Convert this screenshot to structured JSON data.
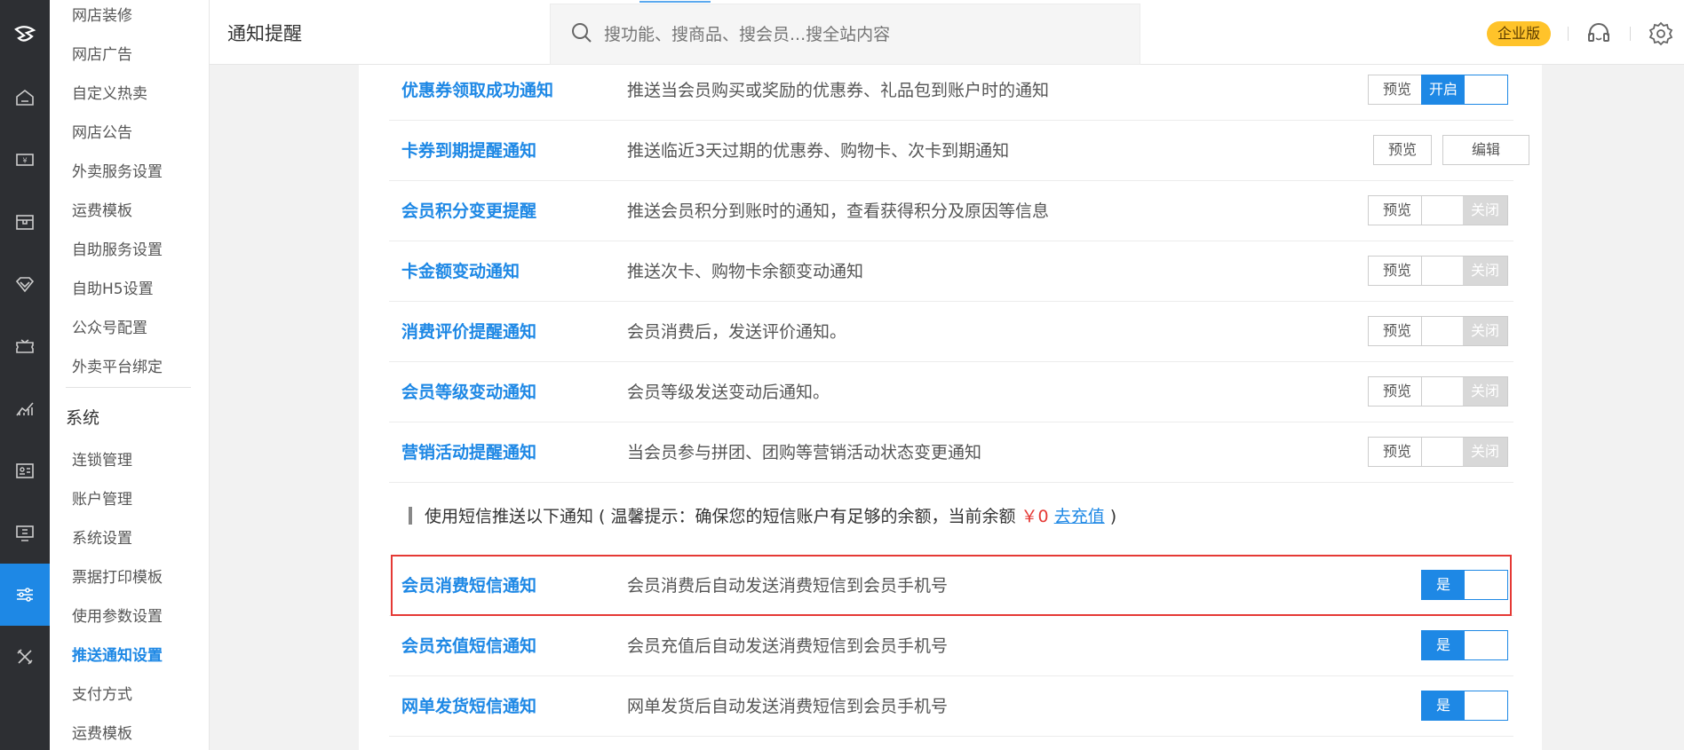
{
  "header": {
    "title": "通知提醒",
    "search_placeholder": "搜功能、搜商品、搜会员...搜全站内容",
    "edition_badge": "企业版"
  },
  "rail_icons": [
    "logo-icon",
    "home-icon",
    "cash-icon",
    "goods-icon",
    "member-icon",
    "coupon-icon",
    "chart-icon",
    "card-icon",
    "screen-icon",
    "settings-sliders-icon",
    "tools-icon"
  ],
  "submenu": {
    "items_top": [
      "网店装修",
      "网店广告",
      "自定义热卖",
      "网店公告",
      "外卖服务设置",
      "运费模板",
      "自助服务设置",
      "自助H5设置",
      "公众号配置",
      "外卖平台绑定"
    ],
    "group_label": "系统",
    "items_system": [
      "连锁管理",
      "账户管理",
      "系统设置",
      "票据打印模板",
      "使用参数设置",
      "推送通知设置",
      "支付方式",
      "运费模板"
    ],
    "active_item": "推送通知设置"
  },
  "rows": [
    {
      "name": "优惠券领取成功通知",
      "desc": "推送当会员购买或奖励的优惠券、礼品包到账户时的通知",
      "preview": "预览",
      "toggle_label": "开启",
      "toggle_on": true
    },
    {
      "name": "卡券到期提醒通知",
      "desc": "推送临近3天过期的优惠券、购物卡、次卡到期通知",
      "preview": "预览",
      "edit": "编辑"
    },
    {
      "name": "会员积分变更提醒",
      "desc": "推送会员积分到账时的通知，查看获得积分及原因等信息",
      "preview": "预览",
      "toggle_label": "关闭",
      "toggle_on": false
    },
    {
      "name": "卡金额变动通知",
      "desc": "推送次卡、购物卡余额变动通知",
      "preview": "预览",
      "toggle_label": "关闭",
      "toggle_on": false
    },
    {
      "name": "消费评价提醒通知",
      "desc": "会员消费后，发送评价通知。",
      "preview": "预览",
      "toggle_label": "关闭",
      "toggle_on": false
    },
    {
      "name": "会员等级变动通知",
      "desc": "会员等级发送变动后通知。",
      "preview": "预览",
      "toggle_label": "关闭",
      "toggle_on": false
    },
    {
      "name": "营销活动提醒通知",
      "desc": "当会员参与拼团、团购等营销活动状态变更通知",
      "preview": "预览",
      "toggle_label": "关闭",
      "toggle_on": false
    }
  ],
  "sms_note": {
    "prefix": "使用短信推送以下通知 ( 温馨提示：确保您的短信账户有足够的余额，当前余额",
    "balance": "￥0",
    "recharge_link": "去充值",
    "suffix": ")"
  },
  "sms_rows": [
    {
      "name": "会员消费短信通知",
      "desc": "会员消费后自动发送消费短信到会员手机号",
      "toggle_label": "是",
      "toggle_on": true
    },
    {
      "name": "会员充值短信通知",
      "desc": "会员充值后自动发送消费短信到会员手机号",
      "toggle_label": "是",
      "toggle_on": true
    },
    {
      "name": "网单发货短信通知",
      "desc": "网单发货后自动发送消费短信到会员手机号",
      "toggle_label": "是",
      "toggle_on": true
    }
  ]
}
